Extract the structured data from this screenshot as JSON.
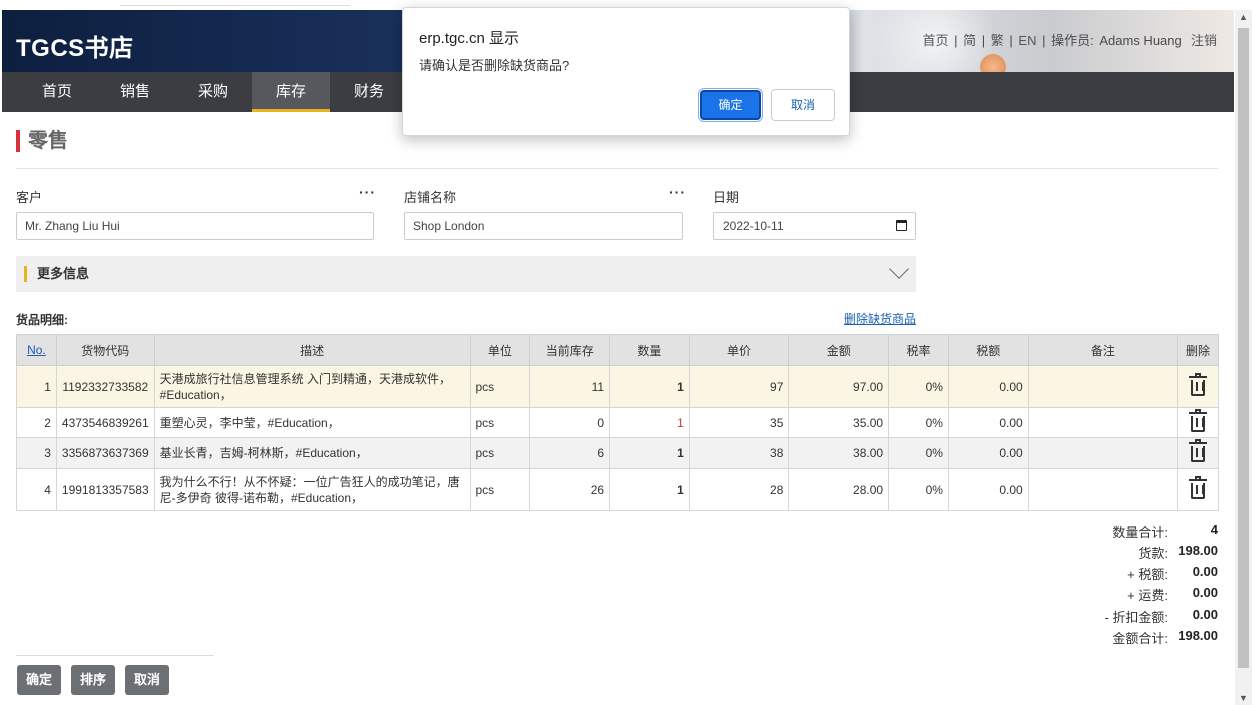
{
  "header": {
    "logo": "TGCS书店",
    "links": [
      "首页",
      "简",
      "繁",
      "EN"
    ],
    "operator_label": "操作员:",
    "operator_name": "Adams Huang",
    "logout": "注销"
  },
  "nav": {
    "items": [
      "首页",
      "销售",
      "采购",
      "库存",
      "财务"
    ],
    "active": "库存"
  },
  "page": {
    "title": "零售"
  },
  "form": {
    "customer_label": "客户",
    "customer_value": "Mr. Zhang Liu Hui",
    "shop_label": "店铺名称",
    "shop_value": "Shop London",
    "date_label": "日期",
    "date_value": "2022-10-11",
    "more_info": "更多信息",
    "more_btn": "···"
  },
  "goods": {
    "section_label": "货品明细:",
    "delete_out_of_stock": "删除缺货商品",
    "columns": [
      "No.",
      "货物代码",
      "描述",
      "单位",
      "当前库存",
      "数量",
      "单价",
      "金额",
      "税率",
      "税额",
      "备注",
      "删除"
    ],
    "rows": [
      {
        "no": "1",
        "code": "1192332733582",
        "desc": "天港成旅行社信息管理系统 入门到精通，天港成软件，#Education，",
        "unit": "pcs",
        "stock": "11",
        "qty": "1",
        "price": "97",
        "amount": "97.00",
        "tax_rate": "0%",
        "tax": "0.00",
        "note": ""
      },
      {
        "no": "2",
        "code": "4373546839261",
        "desc": "重塑心灵，李中莹，#Education，",
        "unit": "pcs",
        "stock": "0",
        "qty": "1",
        "price": "35",
        "amount": "35.00",
        "tax_rate": "0%",
        "tax": "0.00",
        "note": ""
      },
      {
        "no": "3",
        "code": "3356873637369",
        "desc": "基业长青，吉姆-柯林斯，#Education，",
        "unit": "pcs",
        "stock": "6",
        "qty": "1",
        "price": "38",
        "amount": "38.00",
        "tax_rate": "0%",
        "tax": "0.00",
        "note": ""
      },
      {
        "no": "4",
        "code": "1991813357583",
        "desc": "我为什么不行！从不怀疑：一位广告狂人的成功笔记，唐尼-多伊奇 彼得-诺布勒，#Education，",
        "unit": "pcs",
        "stock": "26",
        "qty": "1",
        "price": "28",
        "amount": "28.00",
        "tax_rate": "0%",
        "tax": "0.00",
        "note": ""
      }
    ]
  },
  "totals": {
    "qty_label": "数量合计:",
    "qty": "4",
    "goods_label": "货款:",
    "goods": "198.00",
    "tax_label": "+ 税额:",
    "tax": "0.00",
    "freight_label": "+ 运费:",
    "freight": "0.00",
    "discount_label": "- 折扣金额:",
    "discount": "0.00",
    "total_label": "金额合计:",
    "total": "198.00"
  },
  "buttons": {
    "confirm": "确定",
    "sort": "排序",
    "cancel": "取消"
  },
  "dialog": {
    "title": "erp.tgc.cn 显示",
    "message": "请确认是否删除缺货商品?",
    "ok": "确定",
    "cancel": "取消"
  },
  "colors": {
    "nav_bg": "#3b3d42",
    "accent_yellow": "#e6b420",
    "title_bar_red": "#d3333a",
    "link_blue": "#1a5fb4",
    "dialog_ok_blue": "#1a73e8"
  }
}
